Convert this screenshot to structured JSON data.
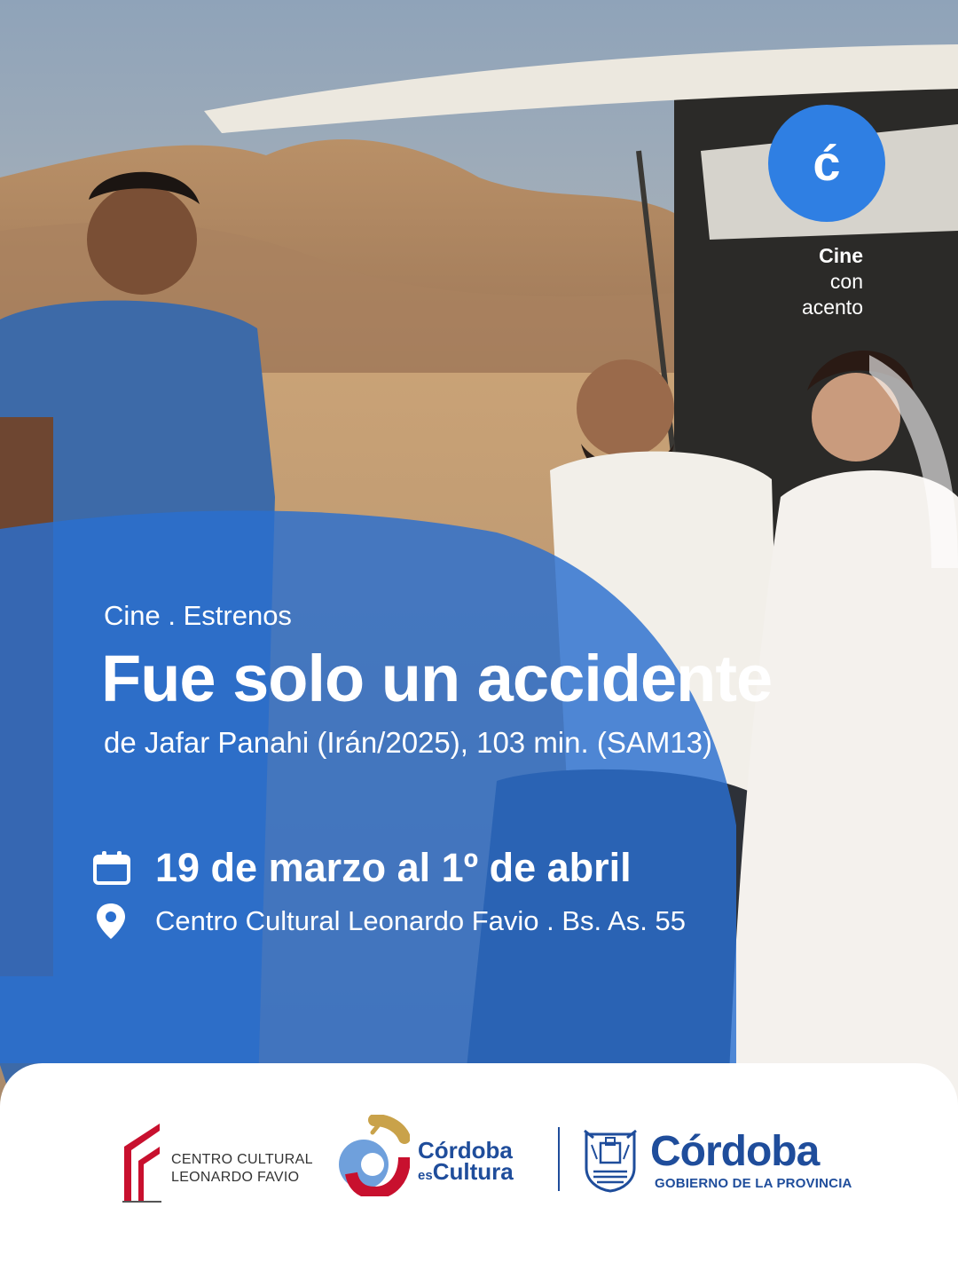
{
  "colors": {
    "brand_blue": "#2a6fcf",
    "badge_blue": "#2f7fe3",
    "navy": "#1f4d9b",
    "red": "#c8102e",
    "gold": "#c9a24a",
    "sky_top": "#9fb1c4",
    "sand": "#c9a077"
  },
  "badge": {
    "letter": "ć",
    "tagline": [
      "Cine",
      "con",
      "acento"
    ]
  },
  "event": {
    "category": "Cine . Estrenos",
    "title": "Fue solo un accidente",
    "subtitle": "de Jafar Panahi (Irán/2025), 103 min. (SAM13)",
    "date": "19 de marzo al 1º de abril",
    "venue": "Centro Cultural Leonardo Favio . Bs. As. 55",
    "date_icon": "calendar-icon",
    "venue_icon": "location-pin-icon"
  },
  "footer": {
    "favio": {
      "line1": "CENTRO CULTURAL",
      "line2": "LEONARDO FAVIO"
    },
    "cordoba_cultura": {
      "line1": "Córdoba",
      "line2_small": "es",
      "line2": "Cultura"
    },
    "gobierno": {
      "name": "Córdoba",
      "sub": "GOBIERNO DE LA PROVINCIA"
    }
  }
}
